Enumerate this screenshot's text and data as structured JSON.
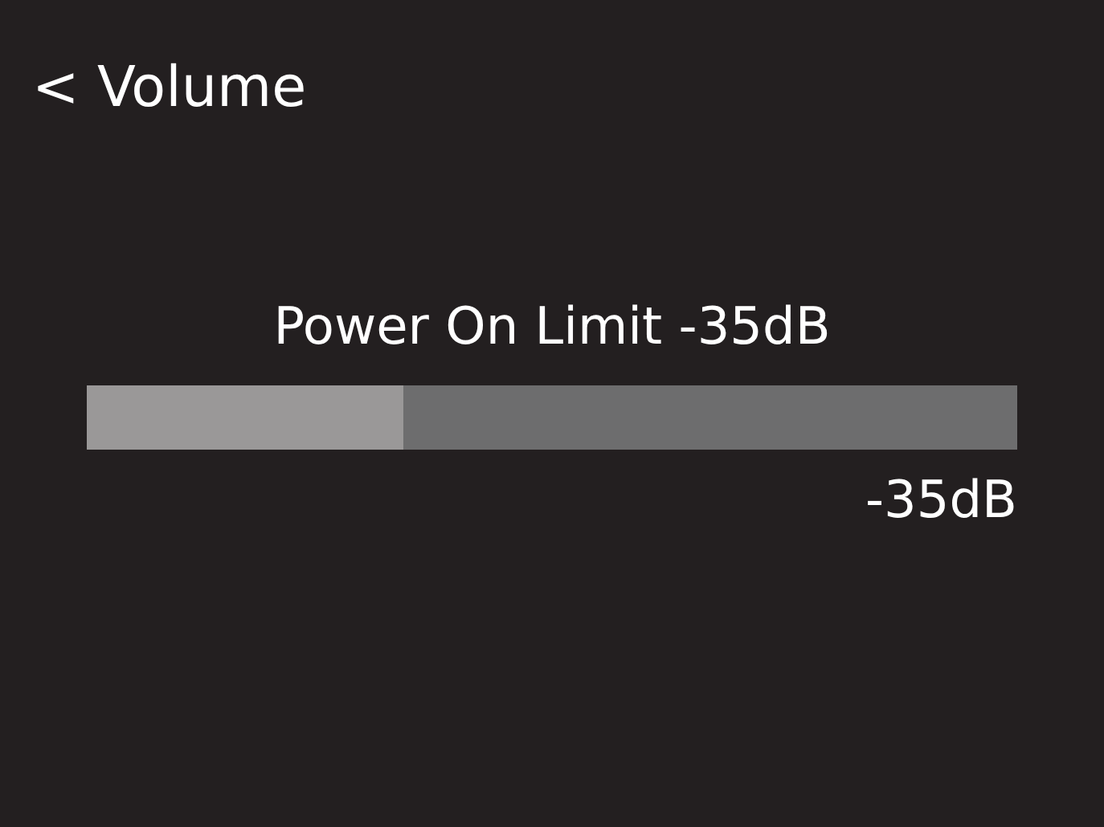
{
  "header": {
    "back": "< Volume"
  },
  "setting": {
    "label": "Power On Limit -35dB",
    "level": 0.34,
    "reading": "-35dB"
  }
}
